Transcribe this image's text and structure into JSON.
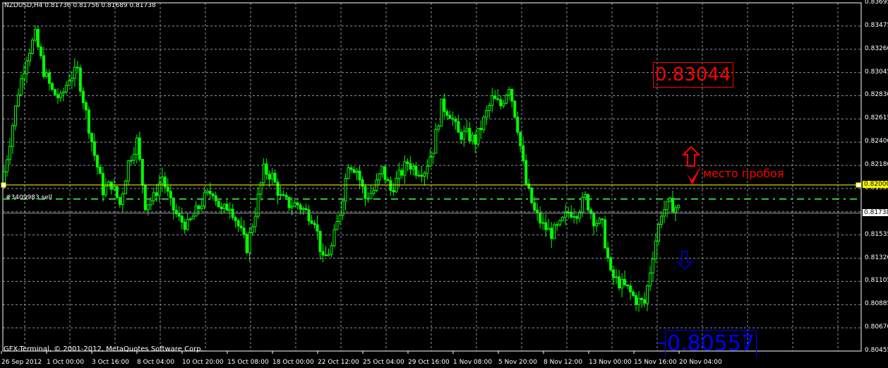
{
  "header": {
    "title": "NZDUSD,H4  0.81736 0.81756 0.81689 0.81738"
  },
  "watermark": "GFX-Terminal, © 2001-2012, MetaQuotes Software Corp.",
  "order_label": "#3409983 sell",
  "annotations": {
    "high_price": "0.83044",
    "low_price": "0.80557",
    "note": "место пробоя",
    "up_arrow": "up-arrow-icon",
    "down_arrow": "down-arrow-icon",
    "check": "check-icon"
  },
  "colors": {
    "bull": "#00ff00",
    "grid": "#8a96a8",
    "level": "#ffff00",
    "order": "#32cd32",
    "annotation_red": "#ff0000",
    "annotation_blue": "#0000ff"
  },
  "chart_data": {
    "type": "candlestick",
    "symbol": "NZDUSD",
    "timeframe": "H4",
    "ylim": [
      0.80455,
      0.83695
    ],
    "y_ticks": [
      "0.83695",
      "0.83475",
      "0.83260",
      "0.83045",
      "0.82830",
      "0.82615",
      "0.82400",
      "0.82180",
      "0.81965",
      "0.81750",
      "0.81535",
      "0.81320",
      "0.81105",
      "0.80885",
      "0.80670",
      "0.80455"
    ],
    "x_ticks": [
      "26 Sep 2012",
      "1 Oct 00:00",
      "3 Oct 16:00",
      "8 Oct 04:00",
      "10 Oct 20:00",
      "15 Oct 08:00",
      "18 Oct 00:00",
      "22 Oct 12:00",
      "25 Oct 04:00",
      "29 Oct 16:00",
      "1 Nov 08:00",
      "5 Nov 20:00",
      "8 Nov 12:00",
      "13 Nov 00:00",
      "15 Nov 16:00",
      "20 Nov 04:00"
    ],
    "current_price": "0.81738",
    "level_price": "0.82000",
    "order_price": 0.8187,
    "approx_closes": [
      0.8198,
      0.8241,
      0.8287,
      0.832,
      0.8339,
      0.8306,
      0.8287,
      0.828,
      0.83,
      0.8306,
      0.8267,
      0.8228,
      0.8195,
      0.8201,
      0.8182,
      0.8221,
      0.8241,
      0.8182,
      0.8188,
      0.8208,
      0.8182,
      0.8168,
      0.8162,
      0.8175,
      0.8188,
      0.8195,
      0.8175,
      0.8182,
      0.8162,
      0.8142,
      0.8175,
      0.8214,
      0.8208,
      0.8188,
      0.8182,
      0.8182,
      0.8175,
      0.8168,
      0.8129,
      0.8142,
      0.8175,
      0.8221,
      0.8214,
      0.8188,
      0.8195,
      0.8214,
      0.8195,
      0.8208,
      0.8221,
      0.8214,
      0.8214,
      0.8234,
      0.8274,
      0.8267,
      0.8247,
      0.8247,
      0.8241,
      0.826,
      0.828,
      0.8274,
      0.8293,
      0.8254,
      0.8201,
      0.8175,
      0.8162,
      0.8155,
      0.8162,
      0.8175,
      0.8175,
      0.8188,
      0.8168,
      0.8162,
      0.8116,
      0.8109,
      0.8103,
      0.8093,
      0.809,
      0.8136,
      0.8175,
      0.8182,
      0.8178
    ]
  }
}
